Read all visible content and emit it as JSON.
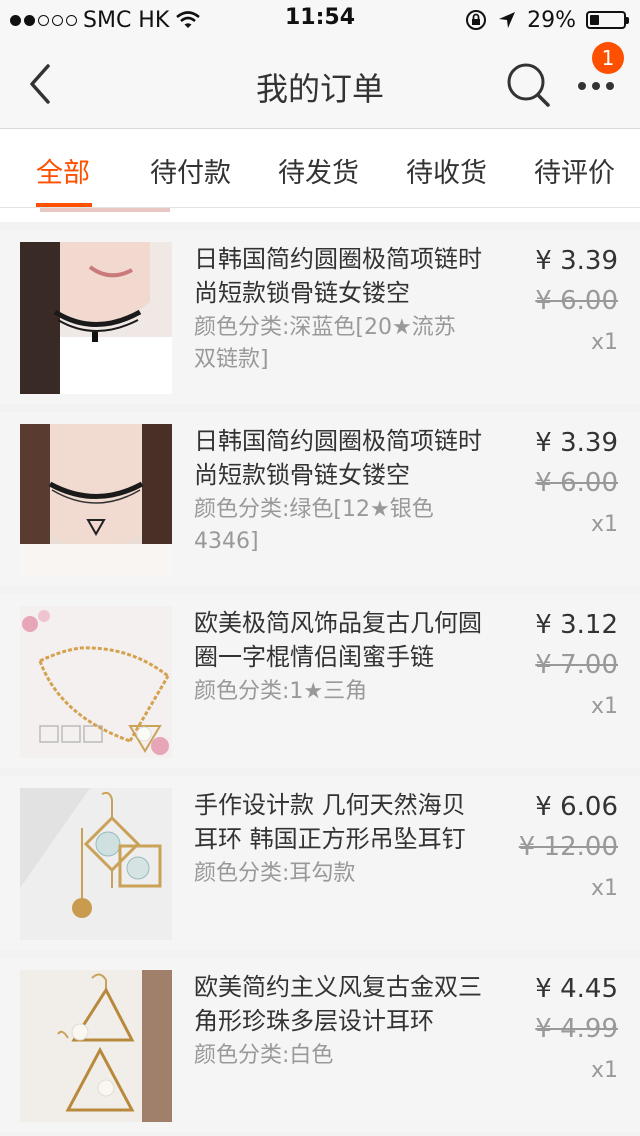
{
  "status_bar": {
    "carrier": "SMC HK",
    "time": "11:54",
    "battery": "29%",
    "battery_level": 0.29
  },
  "nav": {
    "title": "我的订单",
    "badge": "1"
  },
  "tabs": [
    {
      "label": "全部",
      "active": true
    },
    {
      "label": "待付款"
    },
    {
      "label": "待发货"
    },
    {
      "label": "待收货"
    },
    {
      "label": "待评价"
    }
  ],
  "items": [
    {
      "title": "日韩国简约圆圈极简项链时尚短款锁骨链女镂空",
      "spec": "颜色分类:深蓝色[20★流苏双链款]",
      "price": "¥ 3.39",
      "original_price": "¥ 6.00",
      "quantity": "x1"
    },
    {
      "title": "日韩国简约圆圈极简项链时尚短款锁骨链女镂空",
      "spec": "颜色分类:绿色[12★银色4346]",
      "price": "¥ 3.39",
      "original_price": "¥ 6.00",
      "quantity": "x1"
    },
    {
      "title": "欧美极简风饰品复古几何圆圈一字棍情侣闺蜜手链",
      "spec": "颜色分类:1★三角",
      "price": "¥ 3.12",
      "original_price": "¥ 7.00",
      "quantity": "x1"
    },
    {
      "title": "手作设计款 几何天然海贝耳环 韩国正方形吊坠耳钉",
      "spec": "颜色分类:耳勾款",
      "price": "¥ 6.06",
      "original_price": "¥ 12.00",
      "quantity": "x1"
    },
    {
      "title": "欧美简约主义风复古金双三角形珍珠多层设计耳环",
      "spec": "颜色分类:白色",
      "price": "¥ 4.45",
      "original_price": "¥ 4.99",
      "quantity": "x1"
    }
  ]
}
